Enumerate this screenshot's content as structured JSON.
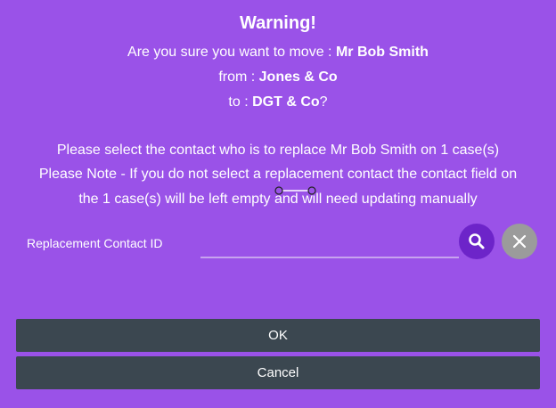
{
  "colors": {
    "background": "#9a52e8",
    "button": "#3b4750",
    "search": "#6d24c9",
    "clear": "#9b9b9b"
  },
  "dialog": {
    "title": "Warning!",
    "move_prefix": "Are you sure you want to move : ",
    "contact_name": "Mr Bob Smith",
    "from_prefix": "from : ",
    "from_company": "Jones & Co",
    "to_prefix": "to : ",
    "to_company": "DGT & Co",
    "to_suffix": "?",
    "note_line1": "Please select the contact who is to replace Mr Bob Smith on 1 case(s)",
    "note_line2": "Please Note - If you do not select a replacement contact the contact field on",
    "note_line3": "the 1 case(s) will be left empty and will need updating manually"
  },
  "replacement": {
    "label": "Replacement Contact ID",
    "value": "",
    "search_icon": "search-icon",
    "clear_icon": "close-icon"
  },
  "buttons": {
    "ok": "OK",
    "cancel": "Cancel"
  }
}
